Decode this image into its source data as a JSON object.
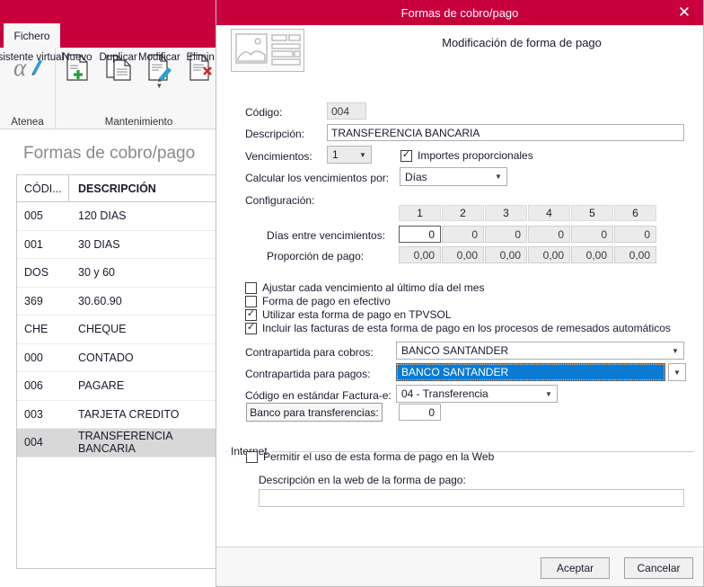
{
  "app": {
    "tab_label": "Fichero",
    "ribbon_groups": [
      {
        "caption": "Atenea",
        "buttons": [
          {
            "label": "Asistente virtual",
            "icon": "alpha-pen-icon"
          }
        ]
      },
      {
        "caption": "Mantenimiento",
        "buttons": [
          {
            "label": "Nuevo",
            "icon": "new-document-icon"
          },
          {
            "label": "Duplicar",
            "icon": "duplicate-document-icon"
          },
          {
            "label": "Modificar",
            "icon": "edit-document-icon"
          },
          {
            "label": "Elimin",
            "icon": "delete-document-icon"
          }
        ]
      }
    ]
  },
  "list_panel": {
    "title": "Formas de cobro/pago",
    "columns": [
      "CÓDI...",
      "DESCRIPCIÓN"
    ],
    "rows": [
      {
        "codigo": "005",
        "descripcion": "120 DIAS",
        "selected": false
      },
      {
        "codigo": "001",
        "descripcion": "30 DIAS",
        "selected": false
      },
      {
        "codigo": "DOS",
        "descripcion": "30 y 60",
        "selected": false
      },
      {
        "codigo": "369",
        "descripcion": "30.60.90",
        "selected": false
      },
      {
        "codigo": "CHE",
        "descripcion": "CHEQUE",
        "selected": false
      },
      {
        "codigo": "000",
        "descripcion": "CONTADO",
        "selected": false
      },
      {
        "codigo": "006",
        "descripcion": "PAGARE",
        "selected": false
      },
      {
        "codigo": "003",
        "descripcion": "TARJETA CREDITO",
        "selected": false
      },
      {
        "codigo": "004",
        "descripcion": "TRANSFERENCIA BANCARIA",
        "selected": true
      }
    ]
  },
  "dialog": {
    "title": "Formas de cobro/pago",
    "close_label": "✕",
    "header_caption": "Modificación de forma de pago",
    "codigo": {
      "label": "Código:",
      "value": "004"
    },
    "descripcion": {
      "label": "Descripción:",
      "value": "TRANSFERENCIA BANCARIA"
    },
    "vencimientos": {
      "label": "Vencimientos:",
      "value": "1"
    },
    "importes_proporcionales": {
      "label": "Importes proporcionales",
      "checked": true
    },
    "calcular_por": {
      "label": "Calcular los vencimientos por:",
      "value": "Días"
    },
    "configuracion": {
      "label": "Configuración:",
      "column_headers": [
        "1",
        "2",
        "3",
        "4",
        "5",
        "6"
      ],
      "dias_label": "Días entre vencimientos:",
      "dias_values": [
        "0",
        "0",
        "0",
        "0",
        "0",
        "0"
      ],
      "proporcion_label": "Proporción de pago:",
      "proporcion_values": [
        "0,00",
        "0,00",
        "0,00",
        "0,00",
        "0,00",
        "0,00"
      ]
    },
    "checkboxes": [
      {
        "label": "Ajustar cada vencimiento al último día del mes",
        "checked": false
      },
      {
        "label": "Forma de pago en efectivo",
        "checked": false
      },
      {
        "label": "Utilizar esta forma de pago en TPVSOL",
        "checked": true
      },
      {
        "label": "Incluir las facturas de esta forma de pago en los procesos de remesados automáticos",
        "checked": true
      }
    ],
    "contrapartida_cobros": {
      "label": "Contrapartida para cobros:",
      "value": "BANCO SANTANDER"
    },
    "contrapartida_pagos": {
      "label": "Contrapartida para pagos:",
      "value": "BANCO SANTANDER",
      "focused": true
    },
    "codigo_factura_e": {
      "label": "Código en estándar Factura-e:",
      "value": "04 - Transferencia"
    },
    "banco_transferencias": {
      "label": "Banco para transferencias:",
      "value": "0"
    },
    "internet": {
      "group_label": "Internet",
      "permitir": {
        "label": "Permitir el uso de esta forma de pago en la Web",
        "checked": false
      },
      "descripcion_web": {
        "label": "Descripción en la web de la forma de pago:",
        "value": "",
        "placeholder": ""
      }
    },
    "buttons": {
      "accept": "Aceptar",
      "cancel": "Cancelar"
    }
  },
  "colors": {
    "brand_red": "#c8003c",
    "selection_blue": "#0a7bd4",
    "focus_orange": "#ffb870"
  }
}
